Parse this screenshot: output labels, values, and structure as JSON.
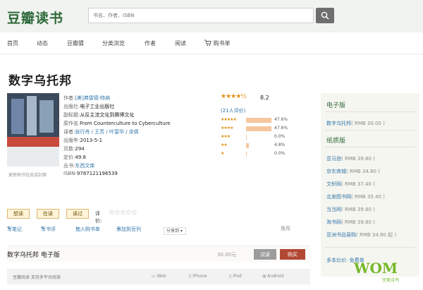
{
  "header": {
    "logo": "豆瓣读书",
    "search_placeholder": "书名、作者、ISBN"
  },
  "nav": [
    "首页",
    "动态",
    "豆瓣猜",
    "分类浏览",
    "作者",
    "阅读",
    "购书单"
  ],
  "book": {
    "title": "数字乌托邦",
    "cover_link": "更新图书信息或封面",
    "info": [
      {
        "label": "作者:",
        "value": "[美]弗雷德·特纳",
        "link": true
      },
      {
        "label": "出版社:",
        "value": "电子工业出版社",
        "link": false
      },
      {
        "label": "副标题:",
        "value": "从反主流文化到赛博文化",
        "link": false
      },
      {
        "label": "原作名:",
        "value": "From Counterculture to Cyberculture",
        "link": false
      },
      {
        "label": "译者:",
        "value": "张行舟 / 王芳 / 叶富华 / 余倩",
        "link": true
      },
      {
        "label": "出版年:",
        "value": "2013-5-1",
        "link": false
      },
      {
        "label": "页数:",
        "value": "294",
        "link": false
      },
      {
        "label": "定价:",
        "value": "49.8",
        "link": false
      },
      {
        "label": "丛书:",
        "value": "东西文库",
        "link": true
      },
      {
        "label": "ISBN:",
        "value": "9787121196539",
        "link": false
      }
    ]
  },
  "rating": {
    "stars": "★★★★½",
    "score": "8.2",
    "count": "(21人评价)",
    "breakdown": [
      {
        "stars": "★★★★★",
        "percent": 47.6,
        "label": "47.6%"
      },
      {
        "stars": "★★★★",
        "percent": 47.6,
        "label": "47.6%"
      },
      {
        "stars": "★★★",
        "percent": 0.0,
        "label": "0.0%"
      },
      {
        "stars": "★★",
        "percent": 4.8,
        "label": "4.8%"
      },
      {
        "stars": "★",
        "percent": 0.0,
        "label": "0.0%"
      }
    ]
  },
  "actions": {
    "want": "想读",
    "reading": "在读",
    "read": "读过",
    "rate_label": "评价:",
    "empty_stars": "☆☆☆☆☆",
    "links": [
      "写笔记",
      "写书评",
      "加入购书单",
      "添加到豆列"
    ],
    "share": "分享到",
    "report": "推荐"
  },
  "ebook": {
    "title": "数字乌托邦 电子版",
    "price": "30.00元",
    "trial": "试读",
    "buy": "购买",
    "note": "豆瓣阅读 支持多平台阅读",
    "platforms": [
      "Web",
      "iPhone",
      "iPad",
      "Android"
    ]
  },
  "sidebar": {
    "ebook_heading": "电子版",
    "ebook_row": {
      "vendor": "数字乌托邦",
      "price": "( RMB 30.00 )"
    },
    "paper_heading": "纸质版",
    "paper_rows": [
      {
        "vendor": "亚马逊",
        "price": "( RMB 39.80 )"
      },
      {
        "vendor": "京东商城",
        "price": "( RMB 34.80 )"
      },
      {
        "vendor": "文轩网",
        "price": "( RMB 37.40 )"
      },
      {
        "vendor": "北发图书网",
        "price": "( RMB 35.40 )"
      },
      {
        "vendor": "当当网",
        "price": "( RMB 39.80 )"
      },
      {
        "vendor": "淘书网",
        "price": "( RMB 39.80 )"
      },
      {
        "vendor": "亚洲书品易购",
        "price": "( RMB 34.80 起 )"
      }
    ],
    "more": "多本比价: 免费单"
  },
  "watermark": {
    "brand": "WOM",
    "sub": "完美诗书"
  },
  "colors": {
    "accent": "#2f6a3b",
    "link": "#3377aa",
    "star": "#e09015",
    "bar": "#f6c79f",
    "buy": "#b24834"
  }
}
